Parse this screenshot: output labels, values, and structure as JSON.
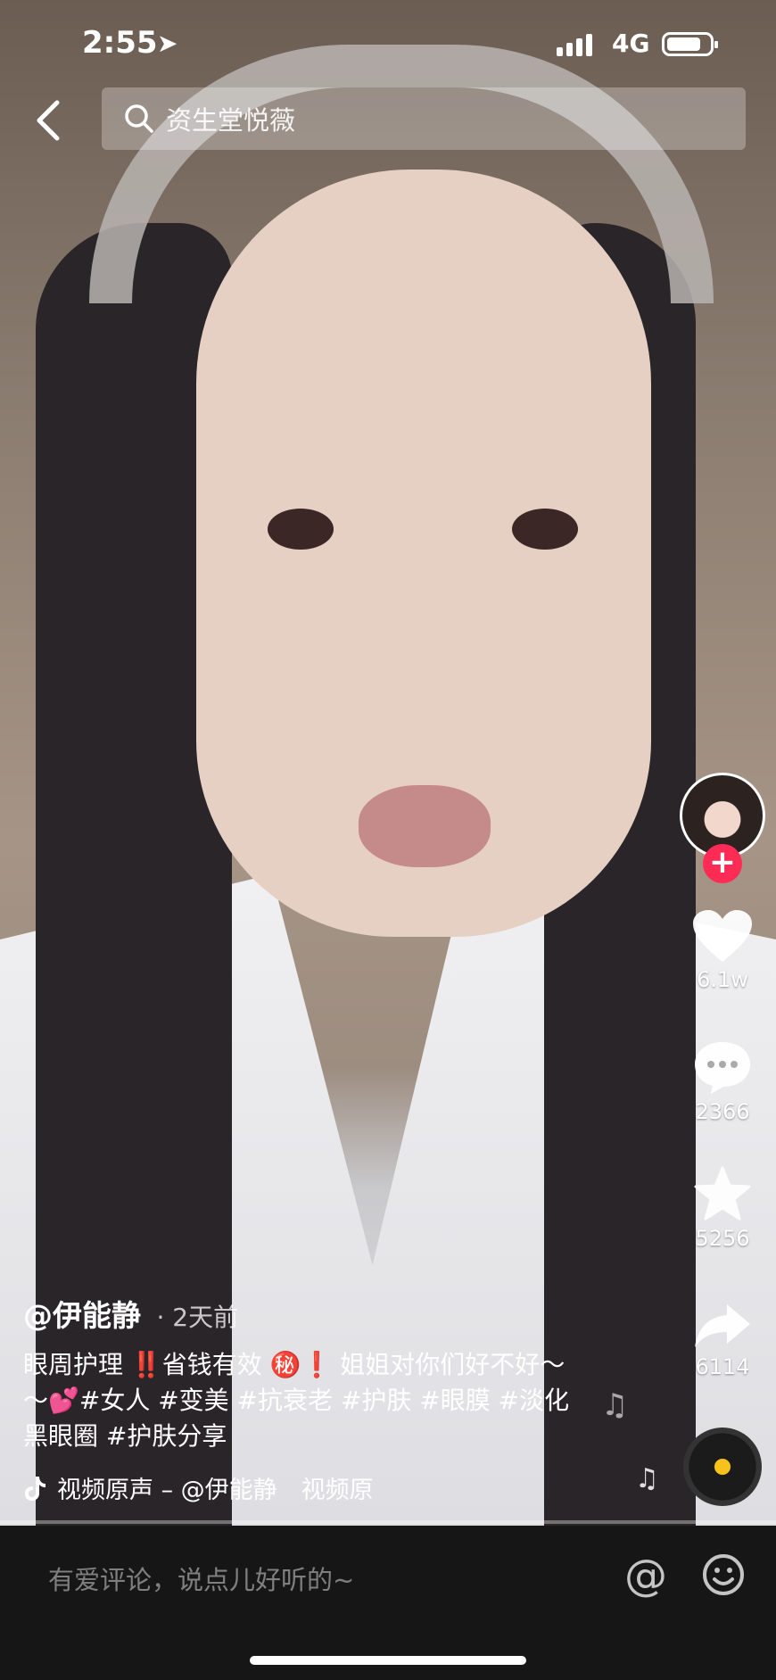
{
  "status_bar": {
    "time": "2:55",
    "network": "4G",
    "battery_level": 0.8
  },
  "search": {
    "placeholder": "资生堂悦薇"
  },
  "rail": {
    "likes": "6.1w",
    "comments": "2366",
    "favorites": "5256",
    "shares": "6114"
  },
  "caption": {
    "username": "@伊能静",
    "posted": "· 2天前",
    "text": "眼周护理 ‼️省钱有效 ㊙️❗️ 姐姐对你们好不好～～💕#女人 #变美 #抗衰老 #护肤 #眼膜 #淡化黑眼圈 #护肤分享"
  },
  "music": {
    "label": "视频原声 – @伊能静　视频原"
  },
  "comment_bar": {
    "placeholder": "有爱评论，说点儿好听的~",
    "at_symbol": "@"
  },
  "colors": {
    "accent": "#fe2c55",
    "disc_center": "#f7c31a"
  }
}
